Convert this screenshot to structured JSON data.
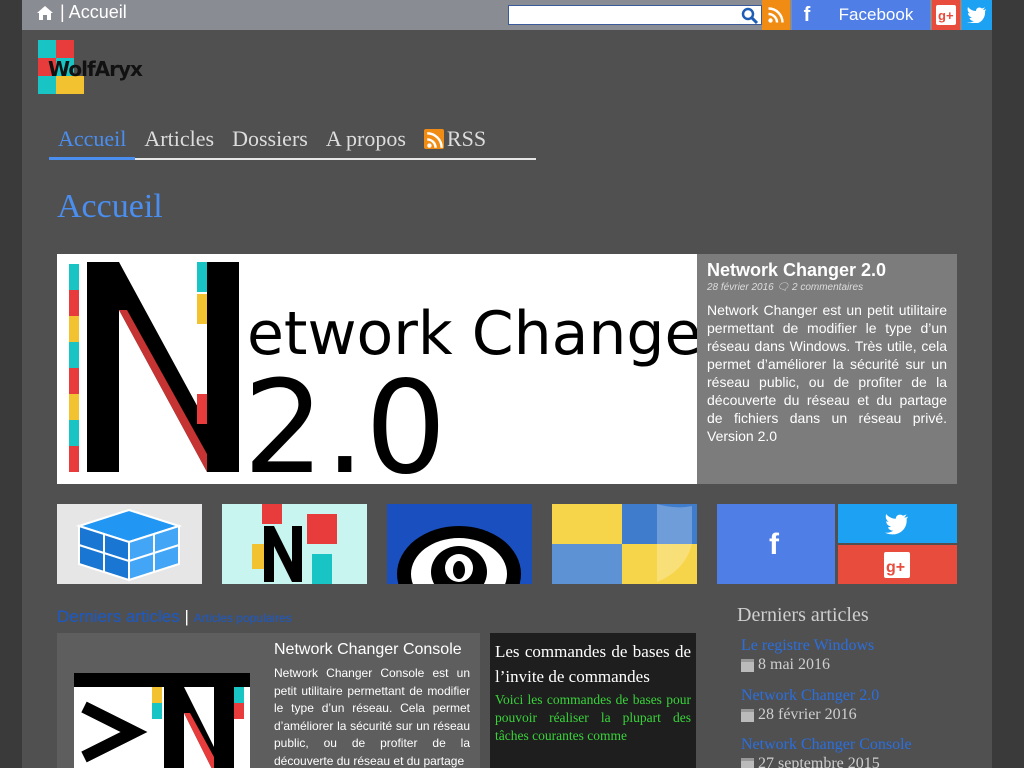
{
  "topbar": {
    "breadcrumb": "| Accueil",
    "search": {
      "placeholder": "",
      "value": ""
    },
    "facebook_label": "Facebook"
  },
  "brand": {
    "name": "WolfAryx"
  },
  "nav": {
    "items": [
      "Accueil",
      "Articles",
      "Dossiers",
      "A propos",
      "RSS"
    ]
  },
  "page": {
    "title": "Accueil"
  },
  "featured": {
    "title": "Network Changer 2.0",
    "date": "28 février 2016",
    "comments": "2 commentaires",
    "excerpt": "Network Changer est un petit utilitaire permettant de modifier le type d’un réseau dans Windows. Très utile, cela permet d’améliorer la sécurité sur un réseau public, ou de profiter de la découverte du réseau et du partage de fichiers dans un réseau privé. Version 2.0",
    "image_text": {
      "line1": "etwork Changer",
      "line2": "2.0",
      "letter": "N"
    }
  },
  "tabs": {
    "active": "Derniers articles",
    "separator": "|",
    "other": "Articles populaires"
  },
  "post1": {
    "title": "Network Changer Console",
    "text": "Network Changer Console est un petit utilitaire permettant de modifier le type d’un réseau. Cela permet d’améliorer la sécurité sur un réseau public, ou de profiter de la découverte du réseau et du partage"
  },
  "post2": {
    "title": "Les commandes de bases de l’invite de commandes",
    "text": "Voici les commandes de bases pour pouvoir réaliser la plupart des tâches courantes comme"
  },
  "sidebar": {
    "title": "Derniers articles",
    "items": [
      {
        "label": "Le registre Windows",
        "date": "8 mai 2016"
      },
      {
        "label": "Network Changer 2.0",
        "date": "28 février 2016"
      },
      {
        "label": "Network Changer Console",
        "date": "27 septembre 2015"
      }
    ]
  },
  "colors": {
    "accent": "#4a8ef0",
    "facebook": "#4f7fe6",
    "gplus": "#e84c3d",
    "twitter": "#1da1f2",
    "rss": "#f08c14"
  }
}
